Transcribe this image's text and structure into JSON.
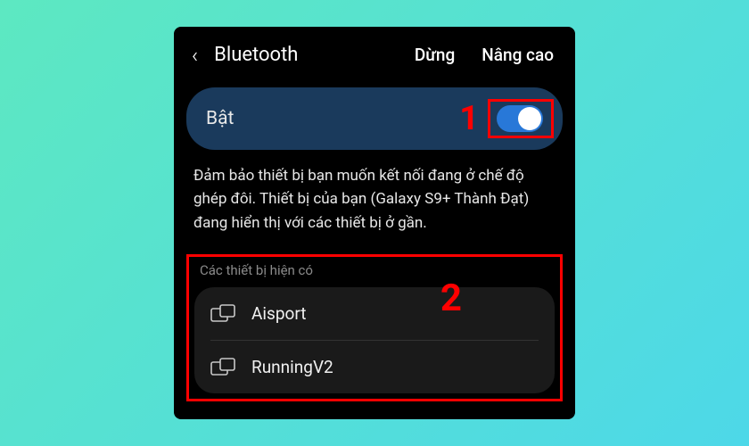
{
  "header": {
    "back_icon": "‹",
    "title": "Bluetooth",
    "action_stop": "Dừng",
    "action_advanced": "Nâng cao"
  },
  "toggle": {
    "label": "Bật",
    "state": "on"
  },
  "description": "Đảm bảo thiết bị bạn muốn kết nối đang ở chế độ ghép đôi. Thiết bị của bạn (Galaxy S9+ Thành Đạt) đang hiển thị với các thiết bị ở gần.",
  "devices": {
    "section_label": "Các thiết bị hiện có",
    "items": [
      {
        "name": "Aisport"
      },
      {
        "name": "RunningV2"
      }
    ]
  },
  "callouts": {
    "num1": "1",
    "num2": "2"
  }
}
